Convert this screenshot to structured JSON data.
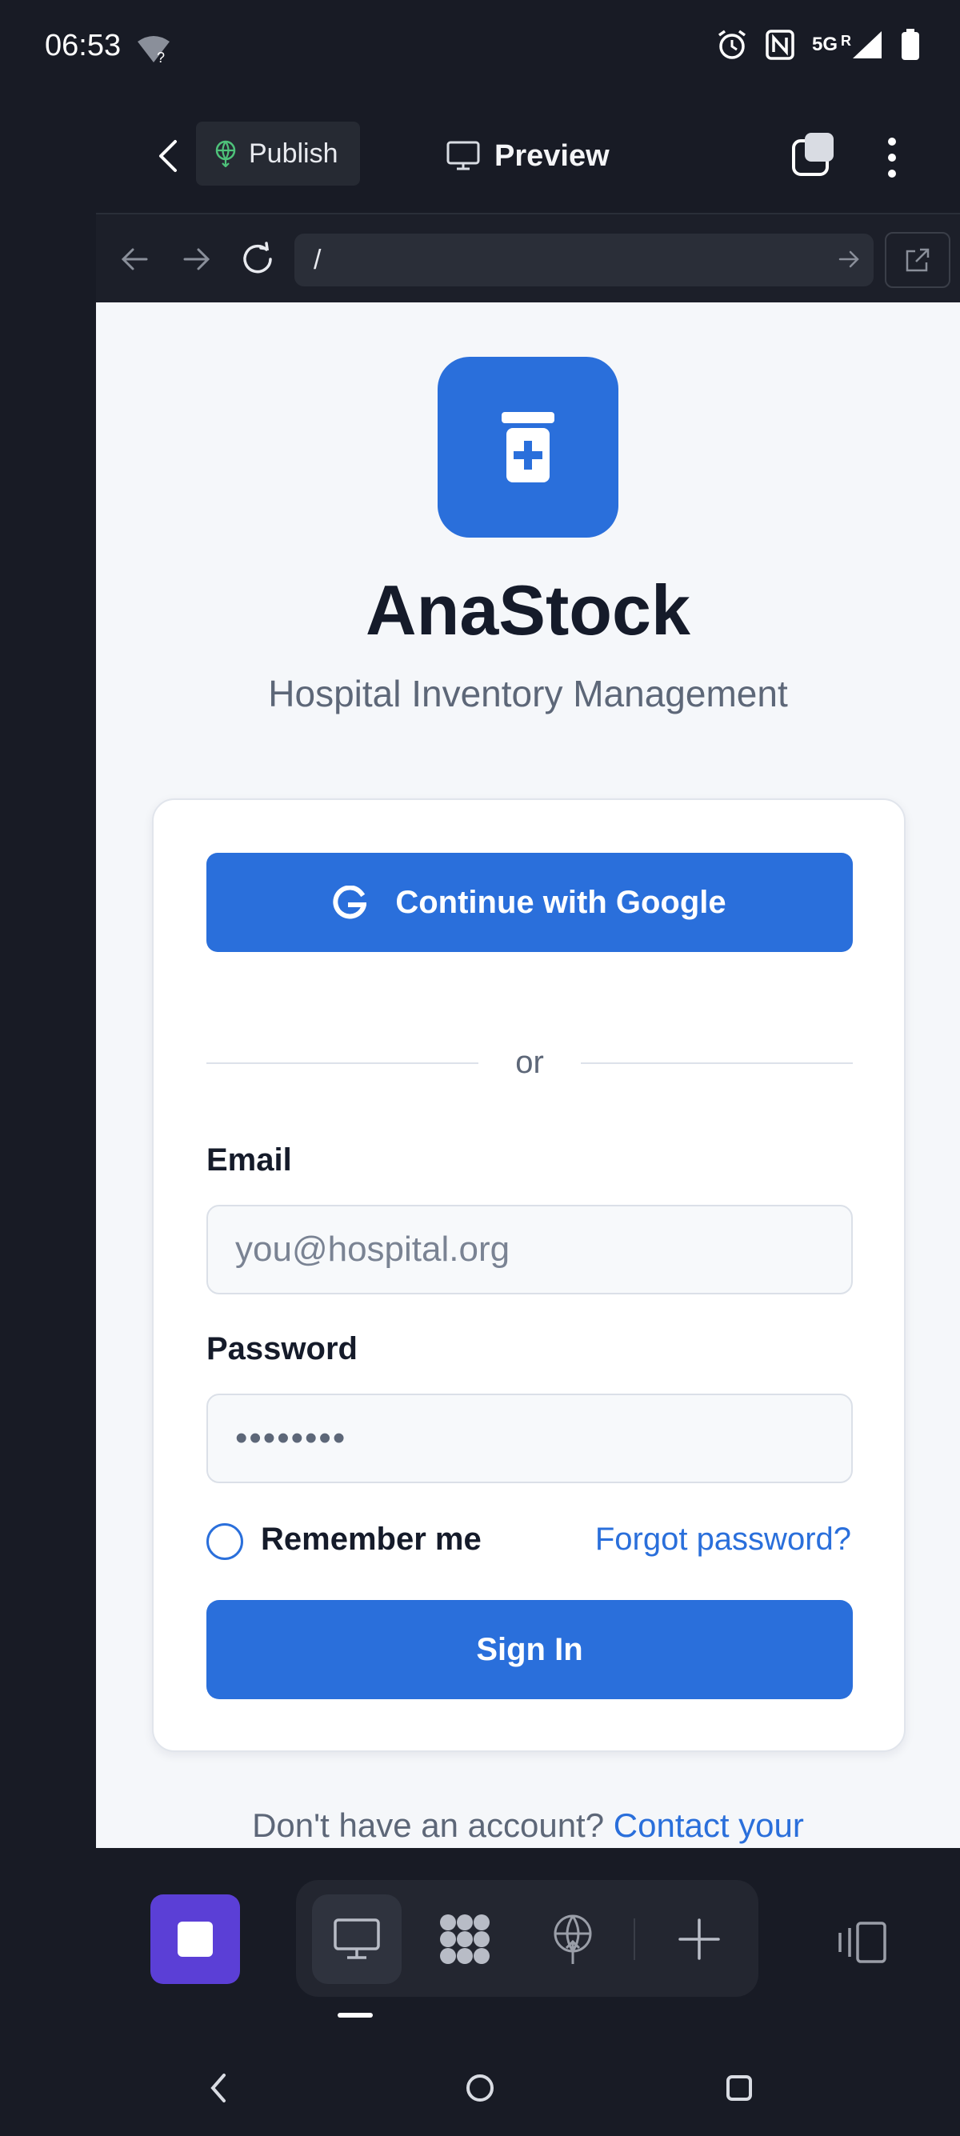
{
  "status_bar": {
    "time": "06:53",
    "network_label": "5G",
    "roaming_label": "R",
    "icons": [
      "wifi-question-icon",
      "alarm-icon",
      "nfc-icon",
      "signal-icon",
      "battery-icon"
    ]
  },
  "app_bar": {
    "publish_label": "Publish",
    "preview_label": "Preview"
  },
  "browser": {
    "url": "/"
  },
  "page": {
    "title": "AnaStock",
    "subtitle": "Hospital Inventory Management",
    "google_button_label": "Continue with Google",
    "divider_text": "or",
    "email_label": "Email",
    "email_placeholder": "you@hospital.org",
    "password_label": "Password",
    "password_value": "••••••••",
    "remember_label": "Remember me",
    "forgot_label": "Forgot password?",
    "signin_label": "Sign In",
    "signup_prefix": "Don't have an account?",
    "signup_link": "Contact your"
  },
  "colors": {
    "accent": "#2a6fdb",
    "stop_button": "#5b3fd6",
    "background_dark": "#181b25"
  }
}
